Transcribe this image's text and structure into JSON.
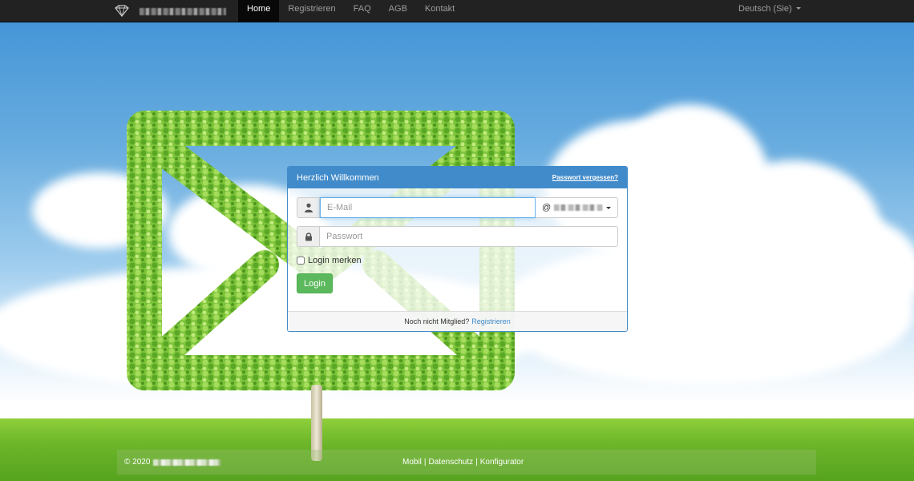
{
  "navbar": {
    "items": [
      {
        "label": "Home",
        "active": true
      },
      {
        "label": "Registrieren"
      },
      {
        "label": "FAQ"
      },
      {
        "label": "AGB"
      },
      {
        "label": "Kontakt"
      }
    ],
    "language": "Deutsch (Sie)"
  },
  "login": {
    "title": "Herzlich Willkommen",
    "forgot_password": "Passwort vergessen?",
    "email_placeholder": "E-Mail",
    "domain_prefix": "@",
    "password_placeholder": "Passwort",
    "remember_label": "Login merken",
    "login_button": "Login",
    "footer_text": "Noch nicht Mitglied?",
    "register_link": "Registrieren"
  },
  "footer": {
    "copyright": "© 2020",
    "links": [
      "Mobil",
      "Datenschutz",
      "Konfigurator"
    ],
    "separator": "|"
  },
  "colors": {
    "navbar": "#222222",
    "primary": "#428bca",
    "success": "#5cb85c"
  },
  "icons": {
    "username": "user-icon",
    "password": "lock-icon",
    "logo": "diamond-logo-icon"
  }
}
